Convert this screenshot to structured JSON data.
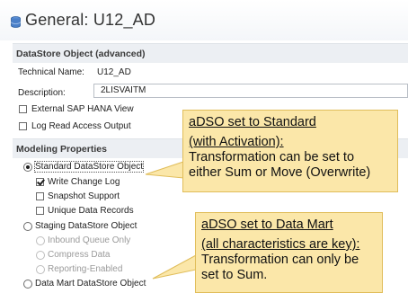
{
  "header": {
    "title": "General: U12_AD",
    "icon": "database-icon"
  },
  "datastore_section": {
    "title": "DataStore Object (advanced)",
    "technical_name_label": "Technical Name:",
    "technical_name_value": "U12_AD",
    "description_label": "Description:",
    "description_value": "2LISVAITM",
    "external_hana_view": {
      "label": "External SAP HANA View",
      "checked": false
    },
    "log_read_access": {
      "label": "Log Read Access Output",
      "checked": false
    }
  },
  "modeling_section": {
    "title": "Modeling Properties",
    "standard": {
      "label": "Standard DataStore Object",
      "selected": true
    },
    "write_change_log": {
      "label": "Write Change Log",
      "checked": true
    },
    "snapshot_support": {
      "label": "Snapshot Support",
      "checked": false
    },
    "unique_data_records": {
      "label": "Unique Data Records",
      "checked": false
    },
    "staging": {
      "label": "Staging DataStore Object",
      "selected": false
    },
    "inbound_queue_only": {
      "label": "Inbound Queue Only",
      "enabled": false
    },
    "compress_data": {
      "label": "Compress Data",
      "enabled": false
    },
    "reporting_enabled": {
      "label": "Reporting-Enabled",
      "enabled": false
    },
    "data_mart": {
      "label": "Data Mart DataStore Object",
      "selected": false
    }
  },
  "callouts": {
    "standard": {
      "line1": "aDSO set to Standard",
      "line2": "(with Activation):",
      "line3": "Transformation can be set to",
      "line4": "either Sum or Move (Overwrite)"
    },
    "data_mart": {
      "line1": "aDSO set to Data Mart",
      "line2": "(all characteristics are key):",
      "line3": "Transformation can only be",
      "line4": "set to Sum."
    }
  },
  "colors": {
    "callout_fill": "#fbe7a9",
    "callout_border": "#e0bd5a",
    "section_bar": "#eceff3"
  }
}
